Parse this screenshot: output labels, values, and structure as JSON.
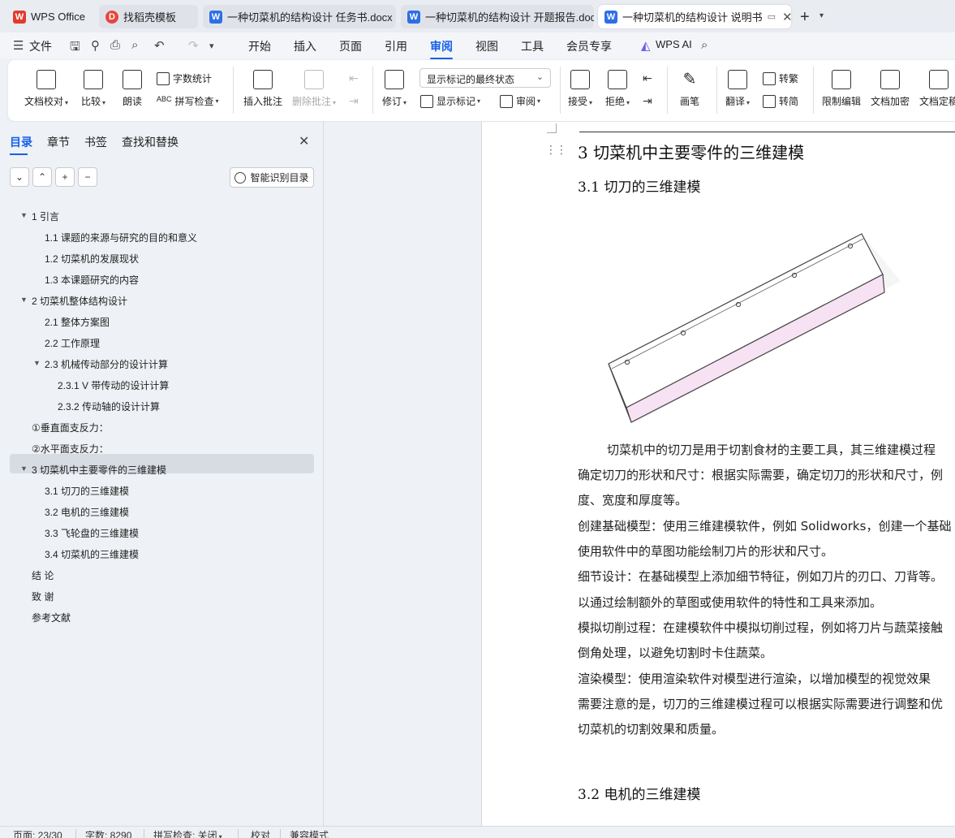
{
  "tabs": [
    {
      "label": "WPS Office",
      "icon": "wps-logo"
    },
    {
      "label": "找稻壳模板",
      "icon": "docer-icon"
    },
    {
      "label": "一种切菜机的结构设计 任务书.docx",
      "icon": "word-doc-icon"
    },
    {
      "label": "一种切菜机的结构设计 开题报告.docx",
      "icon": "word-doc-icon"
    },
    {
      "label": "一种切菜机的结构设计 说明书",
      "icon": "word-doc-icon"
    }
  ],
  "menubar": {
    "file": "文件",
    "items": [
      "开始",
      "插入",
      "页面",
      "引用",
      "审阅",
      "视图",
      "工具",
      "会员专享"
    ],
    "active": "审阅",
    "wps_ai": "WPS AI"
  },
  "ribbon": {
    "doc_check": "文档校对",
    "compare": "比较",
    "read_aloud": "朗读",
    "word_count": "字数统计",
    "spell_check": "拼写检查",
    "insert_comment": "插入批注",
    "delete_comment": "删除批注",
    "track_changes": "修订",
    "markup_state": "显示标记的最终状态",
    "show_markup": "显示标记",
    "review": "审阅",
    "accept": "接受",
    "reject": "拒绝",
    "pen": "画笔",
    "translate": "翻译",
    "to_traditional": "转繁",
    "to_simplified": "转简",
    "restrict_edit": "限制编辑",
    "doc_encrypt": "文档加密",
    "doc_finalize": "文档定稿"
  },
  "sidebar": {
    "tabs": [
      "目录",
      "章节",
      "书签",
      "查找和替换"
    ],
    "smart_toc": "智能识别目录",
    "toc": [
      {
        "label": "1  引言",
        "level": 1,
        "expanded": true
      },
      {
        "label": "1.1  课题的来源与研究的目的和意义",
        "level": 2
      },
      {
        "label": "1.2  切菜机的发展现状",
        "level": 2
      },
      {
        "label": "1.3  本课题研究的内容",
        "level": 2
      },
      {
        "label": "2  切菜机整体结构设计",
        "level": 1,
        "expanded": true
      },
      {
        "label": "2.1  整体方案图",
        "level": 2
      },
      {
        "label": "2.2  工作原理",
        "level": 2
      },
      {
        "label": "2.3  机械传动部分的设计计算",
        "level": 2,
        "expanded": true
      },
      {
        "label": "2.3.1 V 带传动的设计计算",
        "level": 3
      },
      {
        "label": "2.3.2 传动轴的设计计算",
        "level": 3
      },
      {
        "label": "①垂直面支反力：",
        "level": 1
      },
      {
        "label": "②水平面支反力：",
        "level": 1
      },
      {
        "label": "3  切菜机中主要零件的三维建模",
        "level": 1,
        "expanded": true,
        "selected": true
      },
      {
        "label": "3.1 切刀的三维建模",
        "level": 2
      },
      {
        "label": "3.2  电机的三维建模",
        "level": 2
      },
      {
        "label": "3.3 飞轮盘的三维建模",
        "level": 2
      },
      {
        "label": "3.4 切菜机的三维建模",
        "level": 2
      },
      {
        "label": "结    论",
        "level": 1
      },
      {
        "label": "致    谢",
        "level": 1
      },
      {
        "label": "参考文献",
        "level": 1
      }
    ]
  },
  "document": {
    "chapter_heading": "3  切菜机中主要零件的三维建模",
    "section_31": "3.1 切刀的三维建模",
    "paragraphs": [
      "切菜机中的切刀是用于切割食材的主要工具，其三维建模过程",
      "确定切刀的形状和尺寸：根据实际需要，确定切刀的形状和尺寸，例",
      "度、宽度和厚度等。",
      "创建基础模型：使用三维建模软件，例如 Solidworks，创建一个基础",
      "使用软件中的草图功能绘制刀片的形状和尺寸。",
      "细节设计：在基础模型上添加细节特征，例如刀片的刃口、刀背等。",
      "以通过绘制额外的草图或使用软件的特性和工具来添加。",
      "模拟切削过程：在建模软件中模拟切削过程，例如将刀片与蔬菜接触",
      "倒角处理，以避免切割时卡住蔬菜。",
      "渲染模型：使用渲染软件对模型进行渲染，以增加模型的视觉效果",
      "需要注意的是，切刀的三维建模过程可以根据实际需要进行调整和优",
      "切菜机的切割效果和质量。"
    ],
    "section_32": "3.2  电机的三维建模"
  },
  "statusbar": {
    "page": "页面: 23/30",
    "word_count": "字数: 8290",
    "spell_check": "拼写检查: 关闭",
    "proofread": "校对",
    "compat_mode": "兼容模式"
  }
}
